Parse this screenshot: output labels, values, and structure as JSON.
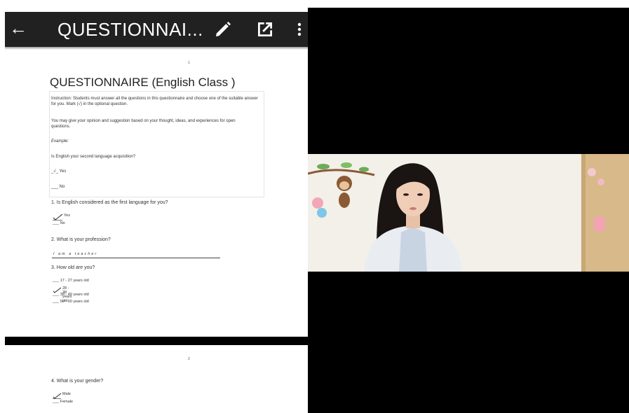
{
  "appbar": {
    "back_icon": "arrow-left-icon",
    "title": "QUESTIONNAI...",
    "edit_icon": "pencil-icon",
    "open_icon": "open-in-new-icon",
    "more_icon": "more-vert-icon"
  },
  "page1": {
    "page_number": "1",
    "title": "QUESTIONNAIRE (English Class )",
    "instruction": "Instruction: Students must answer all the questions in this questionnaire and choose one of the suitable answer for you. Mark (√) in the optional question.",
    "opinion_note": "You may give your opinion and suggestion based on your thought, ideas, and experiences for open questions.",
    "example_label": "Example:",
    "example_question": "Is English your second language acquisition?",
    "example_yes": "_√_ Yes",
    "example_no": "___ No",
    "q1": "1. Is English considered as the first language for you?",
    "q1_yes": "Yes",
    "q1_no": "___ No",
    "q2": "2. What is your profession?",
    "q2_answer": "I am a teacher",
    "q3": "3. How old are you?",
    "q3_opt1": "___ 17 - 27 years old",
    "q3_opt2": "28 - 38 years old",
    "q3_opt3": "___ 39 - 49 years old",
    "q3_opt4": "___ 50 - 60 years old"
  },
  "page2": {
    "page_number": "2",
    "q4": "4. What is your gender?",
    "q4_male": "Male",
    "q4_female": "___ Female"
  },
  "colors": {
    "appbar": "#212121",
    "panel": "#000000",
    "wall": "#f3efe9"
  }
}
